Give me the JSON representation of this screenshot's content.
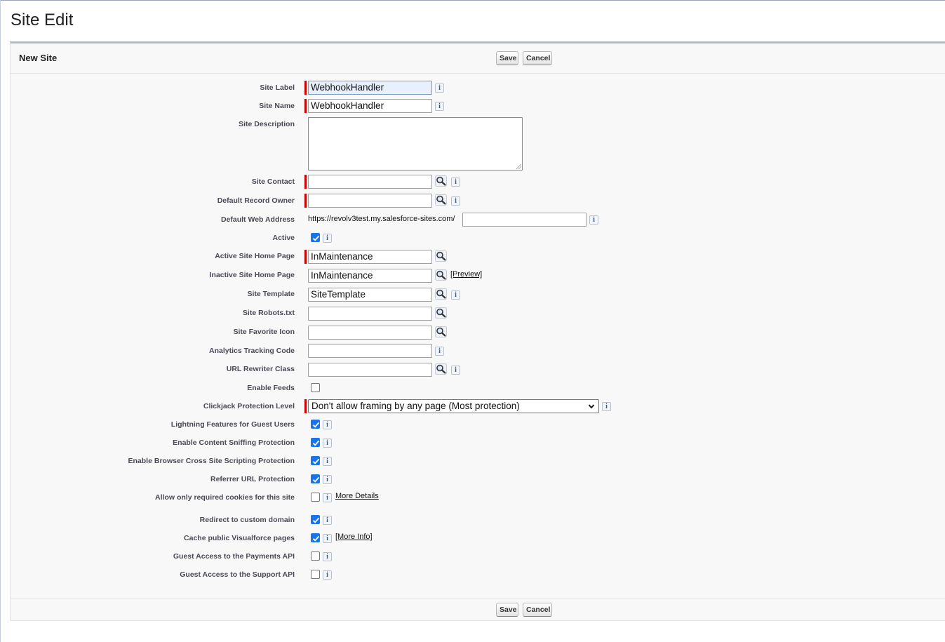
{
  "page": {
    "title": "Site Edit"
  },
  "panel": {
    "title": "New Site",
    "save_label": "Save",
    "cancel_label": "Cancel"
  },
  "fields": {
    "site_label": {
      "label": "Site Label",
      "value": "WebhookHandler"
    },
    "site_name": {
      "label": "Site Name",
      "value": "WebhookHandler"
    },
    "site_description": {
      "label": "Site Description",
      "value": ""
    },
    "site_contact": {
      "label": "Site Contact",
      "value": ""
    },
    "default_record_owner": {
      "label": "Default Record Owner",
      "value": ""
    },
    "default_web_address": {
      "label": "Default Web Address",
      "prefix": "https://revolv3test.my.salesforce-sites.com/",
      "value": ""
    },
    "active": {
      "label": "Active",
      "checked": true
    },
    "active_home": {
      "label": "Active Site Home Page",
      "value": "InMaintenance"
    },
    "inactive_home": {
      "label": "Inactive Site Home Page",
      "value": "InMaintenance",
      "preview_link": "[Preview]"
    },
    "site_template": {
      "label": "Site Template",
      "value": "SiteTemplate"
    },
    "robots": {
      "label": "Site Robots.txt",
      "value": ""
    },
    "favicon": {
      "label": "Site Favorite Icon",
      "value": ""
    },
    "analytics": {
      "label": "Analytics Tracking Code",
      "value": ""
    },
    "url_rewriter": {
      "label": "URL Rewriter Class",
      "value": ""
    },
    "enable_feeds": {
      "label": "Enable Feeds",
      "checked": false
    },
    "clickjack": {
      "label": "Clickjack Protection Level",
      "value": "Don't allow framing by any page (Most protection)"
    },
    "lightning_guest": {
      "label": "Lightning Features for Guest Users",
      "checked": true
    },
    "content_sniffing": {
      "label": "Enable Content Sniffing Protection",
      "checked": true
    },
    "xss": {
      "label": "Enable Browser Cross Site Scripting Protection",
      "checked": true
    },
    "referrer": {
      "label": "Referrer URL Protection",
      "checked": true
    },
    "required_cookies": {
      "label": "Allow only required cookies for this site",
      "checked": false,
      "link": "More Details"
    },
    "redirect_domain": {
      "label": "Redirect to custom domain",
      "checked": true
    },
    "cache_vf": {
      "label": "Cache public Visualforce pages",
      "checked": true,
      "link": "[More Info]"
    },
    "payments_api": {
      "label": "Guest Access to the Payments API",
      "checked": false
    },
    "support_api": {
      "label": "Guest Access to the Support API",
      "checked": false
    }
  },
  "icons": {
    "info": "i",
    "lookup": "lookup-magnifier-icon",
    "check": "checkmark-icon"
  },
  "colors": {
    "required": "#cc0000",
    "checkbox": "#1a73e8",
    "focus": "#e8f0fe"
  }
}
